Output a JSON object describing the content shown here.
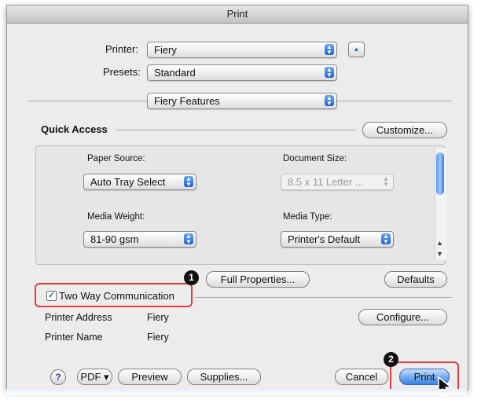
{
  "window": {
    "title": "Print"
  },
  "printer": {
    "label": "Printer:",
    "value": "Fiery"
  },
  "presets": {
    "label": "Presets:",
    "value": "Standard"
  },
  "panel": {
    "value": "Fiery Features"
  },
  "quick_access": {
    "heading": "Quick Access",
    "customize_label": "Customize..."
  },
  "paper_source": {
    "label": "Paper Source:",
    "value": "Auto Tray Select"
  },
  "document_size": {
    "label": "Document Size:",
    "value": "8.5 x 11 Letter ..."
  },
  "media_weight": {
    "label": "Media Weight:",
    "value": "81-90 gsm"
  },
  "media_type": {
    "label": "Media Type:",
    "value": "Printer's Default"
  },
  "buttons": {
    "full_properties": "Full Properties...",
    "defaults": "Defaults",
    "configure": "Configure..."
  },
  "two_way": {
    "label": "Two Way Communication",
    "checked": true
  },
  "printer_address": {
    "label": "Printer Address",
    "value": "Fiery"
  },
  "printer_name": {
    "label": "Printer Name",
    "value": "Fiery"
  },
  "footer": {
    "help": "?",
    "pdf": "PDF ▾",
    "preview": "Preview",
    "supplies": "Supplies...",
    "cancel": "Cancel",
    "print": "Print"
  },
  "callouts": {
    "one": "1",
    "two": "2"
  },
  "colors": {
    "accent": "#3c82e3",
    "callout_red": "#e23c3c"
  }
}
